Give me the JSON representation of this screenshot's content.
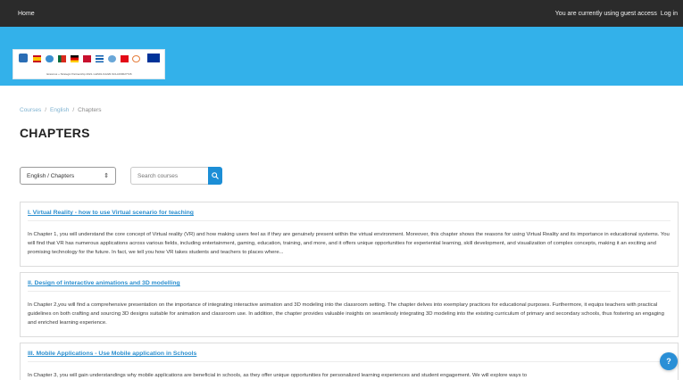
{
  "topbar": {
    "home_label": "Home",
    "guest_text": "You are currently using guest access",
    "login_label": "Log in"
  },
  "banner": {
    "caption": "Erasmus + Strategic Partnership 2021-1-ES01-KA220-SCH-000027726"
  },
  "breadcrumb": {
    "items": [
      "Courses",
      "English",
      "Chapters"
    ],
    "separator": "/"
  },
  "page": {
    "title": "CHAPTERS"
  },
  "filter": {
    "selected": "English / Chapters"
  },
  "search": {
    "placeholder": "Search courses"
  },
  "courses": [
    {
      "title": "I. Virtual Reality - how to use Virtual scenario for teaching",
      "summary": "In Chapter 1, you will understand the core concept of Virtual reality (VR) and how making users feel as if they are genuinely present within the virtual environment. Moreover, this chapter shows the reasons for using Virtual Reality and its importance in educational systems. You will find that VR has numerous applications across various fields, including entertainment, gaming, education, training, and more, and it offers unique opportunities for experiential learning, skill development, and visualization of complex concepts, making it an exciting and promising technology for the future. In fact, we tell you how VR takes students and teachers to places where..."
    },
    {
      "title": "II. Design of interactive animations and 3D modelling",
      "summary": "In Chapter 2,you will find a comprehensive presentation on the importance of integrating interactive animation and 3D modeling into the classroom setting. The chapter delves into exemplary practices for educational purposes. Furthermore, it equips teachers with practical guidelines on both crafting and sourcing 3D designs suitable for animation and classroom use. In addition, the chapter provides valuable insights on seamlessly integrating 3D modeling into the existing curriculum of primary and secondary schools, thus fostering an engaging and enriched learning experience."
    },
    {
      "title": "III. Mobile Applications - Use Mobile application in Schools",
      "summary": "In Chapter 3, you will gain understandings why mobile applications are beneficial in schools, as they offer unique opportunities for personalized learning experiences and student engagement. We will explore ways to"
    }
  ],
  "help": {
    "label": "?"
  },
  "colors": {
    "topbar": "#2b2b2b",
    "banner": "#33b1ea",
    "link": "#2b8fcf",
    "accent": "#1c8ed6"
  }
}
